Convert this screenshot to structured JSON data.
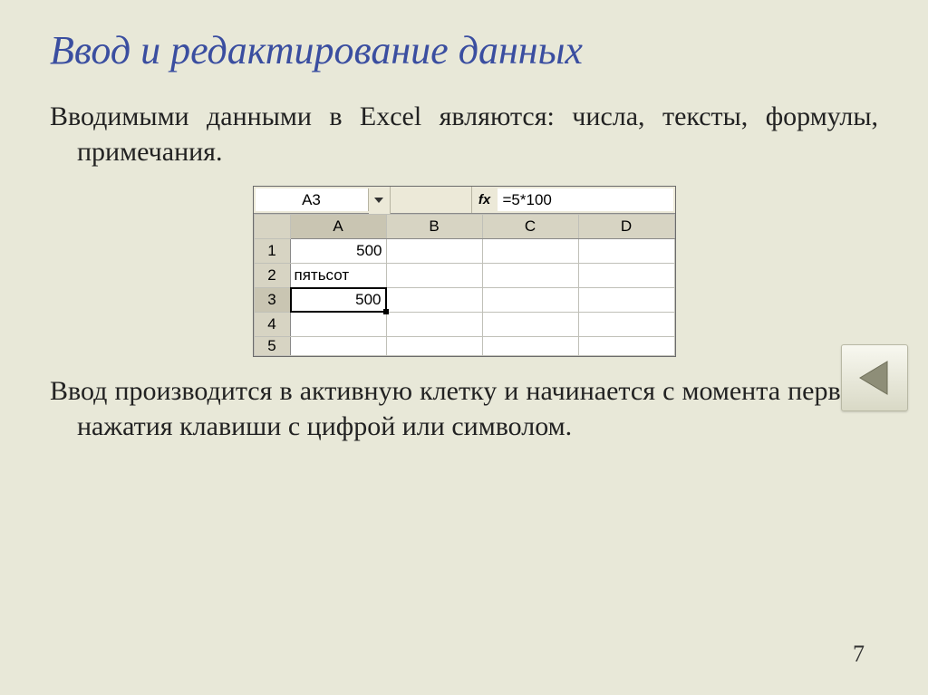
{
  "title": "Ввод и редактирование данных",
  "para1": "Вводимыми данными в Excel являются: числа, тексты, формулы, примечания.",
  "para2": "Ввод производится в активную клетку и начинается с момента первого нажатия клавиши с цифрой или символом.",
  "page_number": "7",
  "excel": {
    "name_box": "A3",
    "fx_label": "fx",
    "formula": "=5*100",
    "columns": [
      "A",
      "B",
      "C",
      "D"
    ],
    "rows": [
      {
        "num": "1",
        "cells": [
          "500",
          "",
          "",
          ""
        ]
      },
      {
        "num": "2",
        "cells": [
          "пятьсот",
          "",
          "",
          ""
        ]
      },
      {
        "num": "3",
        "cells": [
          "500",
          "",
          "",
          ""
        ]
      },
      {
        "num": "4",
        "cells": [
          "",
          "",
          "",
          ""
        ]
      }
    ],
    "partial_row": "5",
    "active_row": 2,
    "active_col": 0
  }
}
